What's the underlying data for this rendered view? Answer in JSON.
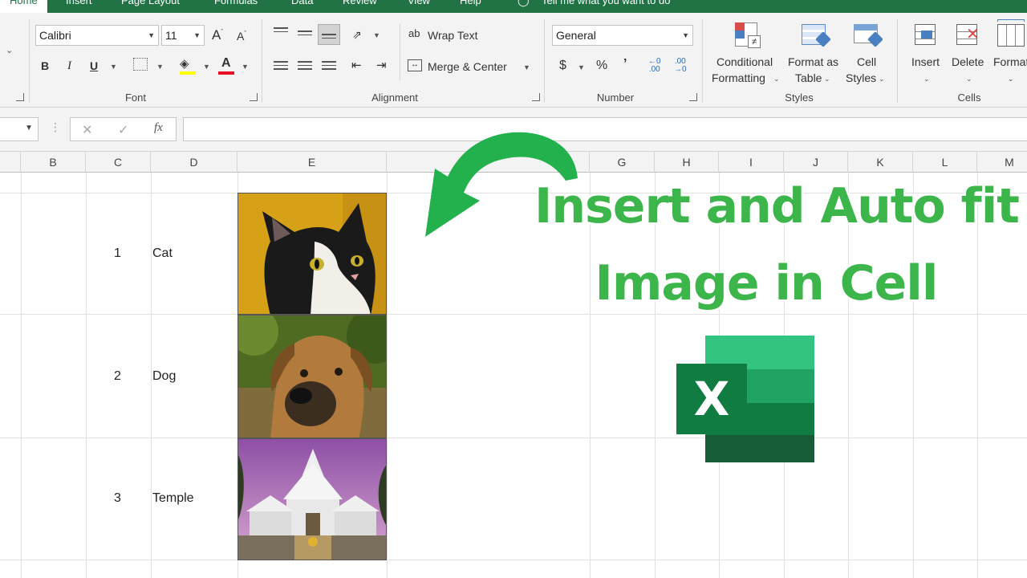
{
  "tabs": [
    "Home",
    "Insert",
    "Page Layout",
    "Formulas",
    "Data",
    "Review",
    "View",
    "Help",
    "Tell me what you want to do"
  ],
  "ribbon": {
    "font_name": "Calibri",
    "font_size": "11",
    "wrap_text": "Wrap Text",
    "merge_center": "Merge & Center",
    "number_format": "General",
    "conditional_formatting": [
      "Conditional",
      "Formatting"
    ],
    "format_as_table": [
      "Format as",
      "Table"
    ],
    "cell_styles": [
      "Cell",
      "Styles"
    ],
    "insert": "Insert",
    "delete": "Delete",
    "format": "Format",
    "groups": {
      "font": "Font",
      "alignment": "Alignment",
      "number": "Number",
      "styles": "Styles",
      "cells": "Cells"
    },
    "bold": "B",
    "italic": "I",
    "underline": "U",
    "currency": "$",
    "percent": "%",
    "comma": "’",
    "font_grow": "A",
    "font_shrink": "A",
    "font_color": "A"
  },
  "formula_bar": {
    "cancel": "✕",
    "enter": "✓",
    "fx": "fx",
    "value": ""
  },
  "columns": [
    "B",
    "C",
    "D",
    "E",
    "G",
    "H",
    "I",
    "J",
    "K",
    "L",
    "M"
  ],
  "rows": [
    {
      "num": "1",
      "name": "Cat",
      "image": "cat"
    },
    {
      "num": "2",
      "name": "Dog",
      "image": "dog"
    },
    {
      "num": "3",
      "name": "Temple",
      "image": "temple"
    }
  ],
  "overlay": {
    "line1": "Insert and Auto fit",
    "line2": "Image in Cell",
    "logo_letter": "X"
  },
  "colors": {
    "excel_green": "#217346",
    "headline_green": "#3cb54a",
    "arrow_green": "#22b14c"
  }
}
